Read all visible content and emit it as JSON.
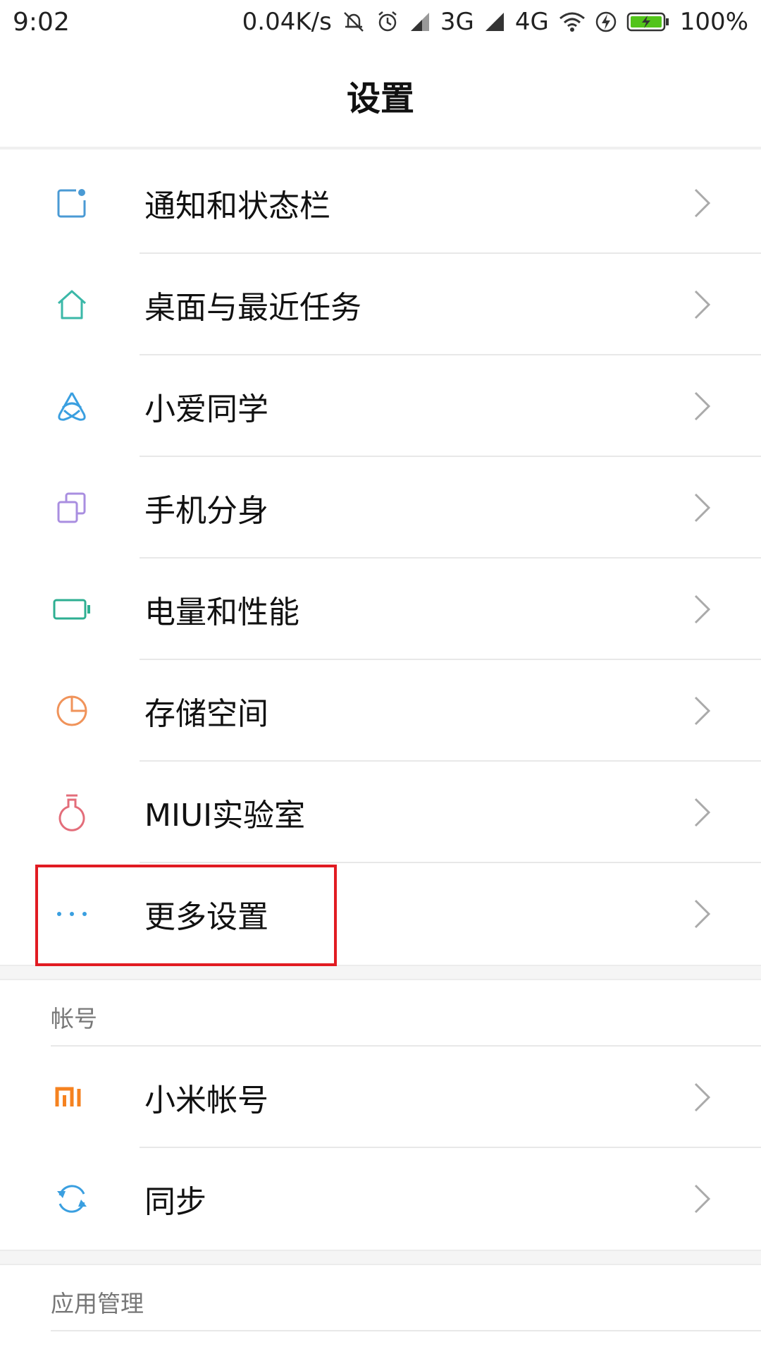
{
  "status_bar": {
    "time": "9:02",
    "net_speed": "0.04K/s",
    "signal1_type": "3G",
    "signal2_type": "4G",
    "battery": "100%"
  },
  "header": {
    "title": "设置"
  },
  "settings": [
    {
      "label": "通知和状态栏",
      "icon": "notification-icon",
      "color": "#4a9ad4"
    },
    {
      "label": "桌面与最近任务",
      "icon": "home-icon",
      "color": "#3bb8a8"
    },
    {
      "label": "小爱同学",
      "icon": "xiaoai-icon",
      "color": "#3a9fe0"
    },
    {
      "label": "手机分身",
      "icon": "second-space-icon",
      "color": "#a98ee0"
    },
    {
      "label": "电量和性能",
      "icon": "battery-icon",
      "color": "#2eaf92"
    },
    {
      "label": "存储空间",
      "icon": "storage-icon",
      "color": "#f0935a"
    },
    {
      "label": "MIUI实验室",
      "icon": "lab-flask-icon",
      "color": "#e36d7a"
    },
    {
      "label": "更多设置",
      "icon": "more-dots-icon",
      "color": "#3a9fe0"
    }
  ],
  "account_section": {
    "title": "帐号",
    "items": [
      {
        "label": "小米帐号",
        "icon": "mi-logo-icon",
        "color": "#f58220"
      },
      {
        "label": "同步",
        "icon": "sync-icon",
        "color": "#3a9fe0"
      }
    ]
  },
  "apps_section": {
    "title": "应用管理"
  }
}
